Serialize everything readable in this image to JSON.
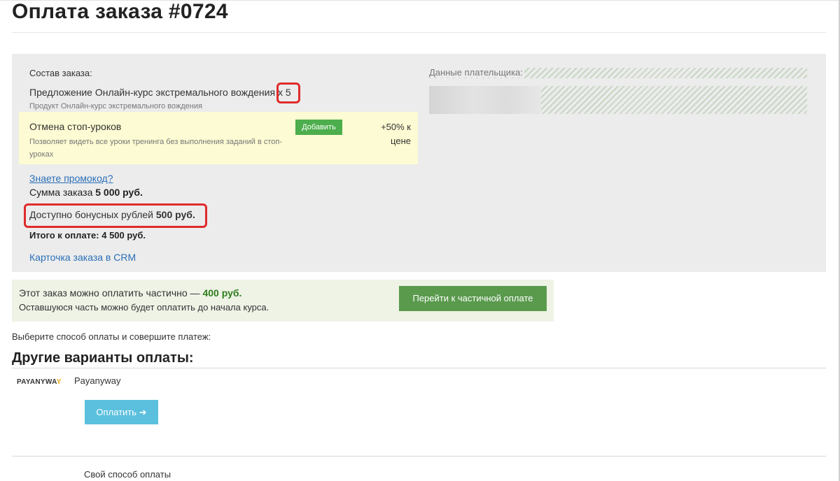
{
  "page": {
    "title": "Оплата заказа #0724"
  },
  "order": {
    "composition_label": "Состав заказа:",
    "offer_text": "Предложение Онлайн-курс экстремального вождения",
    "quantity": "x 5",
    "product_text": "Продукт Онлайн-курс экстремального вождения",
    "upsell": {
      "title": "Отмена стоп-уроков",
      "description": "Позволяет видеть все уроки тренинга без выполнения заданий в стоп-уроках",
      "add_label": "Добавить",
      "price_line1": "+50% к",
      "price_line2": "цене"
    },
    "promo_link": "Знаете промокод?",
    "sum_label": "Сумма заказа",
    "sum_value": "5 000 руб.",
    "bonus_label": "Доступно бонусных рублей",
    "bonus_value": "500 руб.",
    "total_label": "Итого к оплате:",
    "total_value": "4 500 руб.",
    "crm_link": "Карточка заказа в CRM"
  },
  "payer": {
    "label": "Данные плательщика:"
  },
  "partial": {
    "line1_prefix": "Этот заказ можно оплатить частично —",
    "line1_amount": "400 руб.",
    "line2": "Оставшуюся часть можно будет оплатить до начала курса.",
    "button_label": "Перейти к частичной оплате"
  },
  "payment": {
    "choose_text": "Выберите способ оплаты и совершите платеж:",
    "other_heading": "Другие варианты оплаты:",
    "provider_logo_left": "PAYANYWA",
    "provider_logo_y": "Y",
    "provider_name": "Payanyway",
    "pay_button": "Оплатить",
    "pay_arrow": "➜",
    "own_method": "Свой способ оплаты"
  },
  "colors": {
    "highlight_red": "#e02b2b",
    "link_blue": "#2a6fb8",
    "add_green": "#4cae4c",
    "partial_green": "#5a9a4d",
    "pay_cyan": "#5bc0de"
  }
}
